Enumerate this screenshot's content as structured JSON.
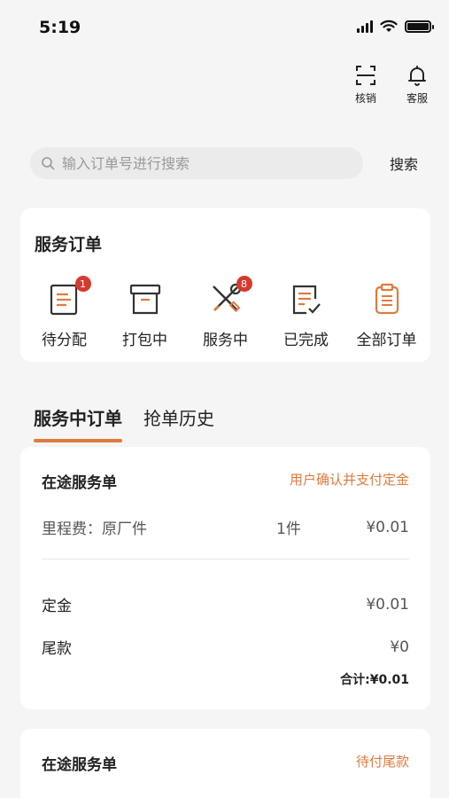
{
  "status_bar": {
    "time": "5:19"
  },
  "top_actions": [
    {
      "label": "核销",
      "icon": "scan-icon"
    },
    {
      "label": "客服",
      "icon": "bell-icon"
    }
  ],
  "search": {
    "placeholder": "输入订单号进行搜索",
    "value": "",
    "button_label": "搜索"
  },
  "service_orders": {
    "title": "服务订单",
    "items": [
      {
        "label": "待分配",
        "icon": "clipboard-list-icon",
        "badge": "1"
      },
      {
        "label": "打包中",
        "icon": "box-icon",
        "badge": ""
      },
      {
        "label": "服务中",
        "icon": "wrench-screwdriver-icon",
        "badge": "8"
      },
      {
        "label": "已完成",
        "icon": "checked-document-icon",
        "badge": ""
      },
      {
        "label": "全部订单",
        "icon": "orange-clipboard-icon",
        "badge": ""
      }
    ]
  },
  "tabs": [
    {
      "label": "服务中订单",
      "active": true
    },
    {
      "label": "抢单历史",
      "active": false
    }
  ],
  "orders": [
    {
      "title": "在途服务单",
      "status": "用户确认并支付定金",
      "item_name": "里程费：原厂件",
      "item_qty": "1件",
      "item_price": "¥0.01",
      "deposit_label": "定金",
      "deposit_value": "¥0.01",
      "final_label": "尾款",
      "final_value": "¥0",
      "total": "合计:¥0.01"
    },
    {
      "title": "在途服务单",
      "status": "待付尾款"
    }
  ],
  "colors": {
    "accent": "#e07a3c",
    "badge": "#d63a2f",
    "background": "#f5f5f5"
  }
}
